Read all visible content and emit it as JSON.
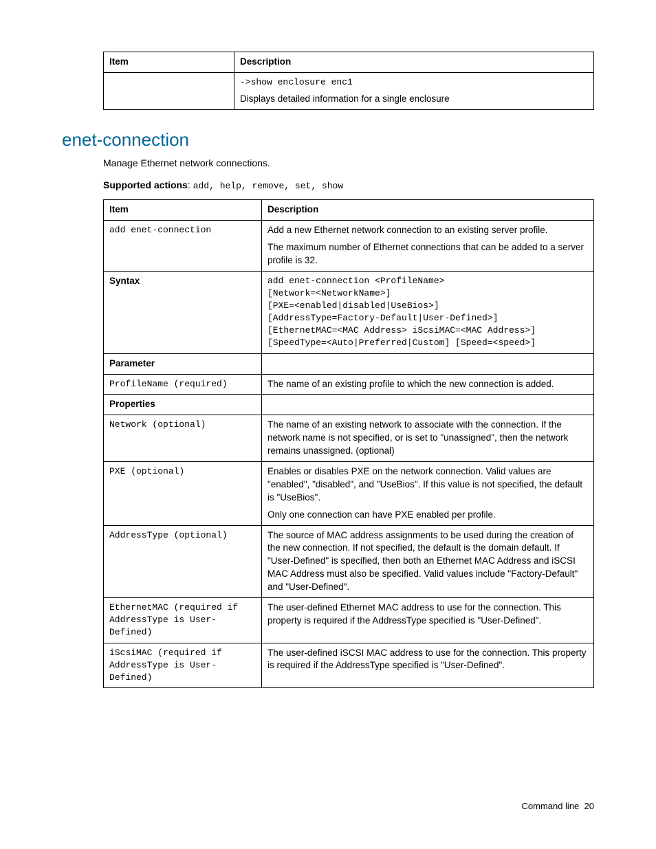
{
  "table1": {
    "headers": {
      "item": "Item",
      "desc": "Description"
    },
    "row1_code": "->show enclosure enc1",
    "row1_text": "Displays detailed information for a single enclosure"
  },
  "section": {
    "title": "enet-connection",
    "intro": "Manage Ethernet network connections.",
    "supported_label": "Supported actions",
    "supported_actions": "add, help, remove, set, show"
  },
  "table2": {
    "headers": {
      "item": "Item",
      "desc": "Description"
    },
    "rows": [
      {
        "item_mono": "add enet-connection",
        "desc_lines": [
          "Add a new Ethernet network connection to an existing server profile.",
          "The maximum number of Ethernet connections that can be added to a server profile is 32."
        ]
      },
      {
        "item_bold": "Syntax",
        "desc_mono_lines": [
          "add enet-connection <ProfileName>",
          "[Network=<NetworkName>]",
          "[PXE=<enabled|disabled|UseBios>]",
          "[AddressType=Factory-Default|User-Defined>]",
          "[EthernetMAC=<MAC Address> iScsiMAC=<MAC Address>]",
          "[SpeedType=<Auto|Preferred|Custom] [Speed=<speed>]"
        ]
      },
      {
        "item_bold": "Parameter",
        "desc_lines": []
      },
      {
        "item_mono": "ProfileName (required)",
        "desc_lines": [
          "The name of an existing profile to which the new connection is added."
        ]
      },
      {
        "item_bold": "Properties",
        "desc_lines": []
      },
      {
        "item_mono": "Network (optional)",
        "desc_lines": [
          "The name of an existing network to associate with the connection. If the network name is not specified, or is set to \"unassigned\", then the network remains unassigned. (optional)"
        ]
      },
      {
        "item_mono": "PXE (optional)",
        "desc_lines": [
          "Enables or disables PXE on the network connection. Valid values are \"enabled\", \"disabled\", and \"UseBios\". If this value is not specified, the default is \"UseBios\".",
          "Only one connection can have PXE enabled per profile."
        ]
      },
      {
        "item_mono": "AddressType (optional)",
        "desc_lines": [
          "The source of MAC address assignments to be used during the creation of the new connection. If not specified, the default is the domain default. If \"User-Defined\" is specified, then both an Ethernet MAC Address and iSCSI MAC Address must also be specified. Valid values include \"Factory-Default\" and \"User-Defined\"."
        ]
      },
      {
        "item_mono": "EthernetMAC (required if AddressType is User-Defined)",
        "desc_lines": [
          "The user-defined Ethernet MAC address to use for the connection. This property is required if the AddressType specified is \"User-Defined\"."
        ]
      },
      {
        "item_mono": "iScsiMAC (required if AddressType is User-Defined)",
        "desc_lines": [
          "The user-defined iSCSI MAC address to use for the connection. This property is required if the AddressType specified is \"User-Defined\"."
        ]
      }
    ]
  },
  "footer": {
    "label": "Command line",
    "page": "20"
  }
}
